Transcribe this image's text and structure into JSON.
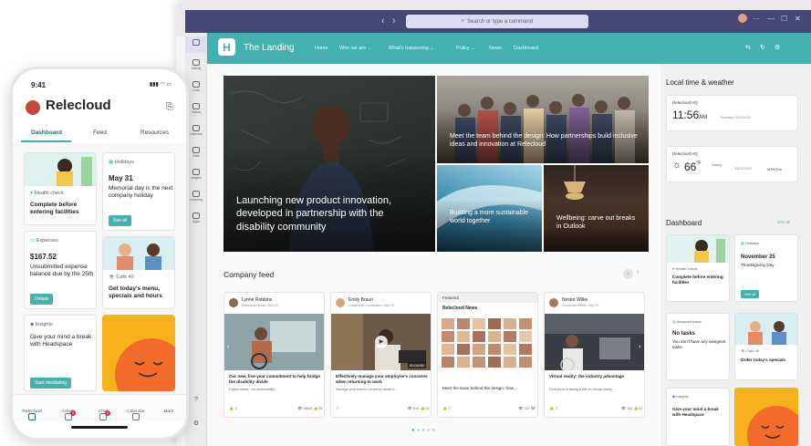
{
  "window": {
    "search_placeholder": "Search or type a command",
    "rail": [
      "Activity",
      "Chat",
      "Teams",
      "Calendar",
      "Files",
      "Insights",
      "Learning",
      "Apps"
    ]
  },
  "site": {
    "logo_letter": "H",
    "name": "The Landing",
    "nav": [
      "Home",
      "Who we are",
      "What's happening",
      "Policy",
      "News",
      "Dashboard"
    ]
  },
  "hero": {
    "t1": "Launching new product innovation, developed in partnership with the disability community",
    "t2": "Meet the team behind the design: How partnerships build inclusive ideas and innovation at Relecloud",
    "t3": "Building a more sustainable world together",
    "t4": "Wellbeing: carve out breaks in Outlook"
  },
  "feed": {
    "title": "Company feed",
    "cards": [
      {
        "name": "Lynne Robbins",
        "sub": "Relecloud News • Sep 19",
        "title": "Our new, five-year commitment to help bridge the disability divide",
        "desc": "Digital divide / an accessibility ...",
        "views": "28/25",
        "likes": "23"
      },
      {
        "name": "Emily Braun",
        "sub": "Leadership Connection • Sep 19",
        "title": "Effectively manage your employee's concerns when returning to work",
        "desc": "Manage your team's concerns about a ...",
        "video_time": "00:04:06",
        "views": "512",
        "likes": "23"
      },
      {
        "featured": "Featured",
        "name": "Relecloud News",
        "sub": "Relecloud News • Sep 19",
        "title": "Meet the team behind the design: how...",
        "views": "112",
        "likes": ""
      },
      {
        "name": "Nestor Wilke",
        "sub": "Consumer Retail • Sep 19",
        "title": "Virtual reality: the industry advantage",
        "desc": "Relecloud is taking a bet on virtual reality ...",
        "views": "112",
        "likes": "12"
      }
    ]
  },
  "right": {
    "time_title": "Local time & weather",
    "hq1": "Relecloud HQ",
    "time": "11:56",
    "ampm": "AM",
    "date": "Tuesday 9/21/2021",
    "hq2": "Relecloud HQ",
    "temp": "66",
    "unit": "°F",
    "cond": "Sunny",
    "date2": "09/21/2021",
    "src": "MSN We",
    "dash_title": "Dashboard",
    "see_all": "See all",
    "holidays_lab": "Holidays",
    "holiday_date": "November 25",
    "holiday_name": "Thanksgiving Day",
    "health_lab": "Health Check",
    "health_txt": "Complete before entering facilities",
    "health_btn": "See all",
    "tasks_lab": "Assigned tasks",
    "tasks_big": "No tasks",
    "tasks_txt": "You don't have any assigned tasks.",
    "cafe_lab": "Cafe 40",
    "cafe_txt": "Order today's specials",
    "insights_lab": "Insights",
    "insights_txt": "Give your mind a break with Headspace"
  },
  "phone": {
    "time": "9:41",
    "app": "Relecloud",
    "tabs": [
      "Dashboard",
      "Feed",
      "Resources"
    ],
    "health_lab": "Health check",
    "health_txt": "Complete before entering facilities",
    "holidays_lab": "Holidays",
    "holiday_date": "May 31",
    "holiday_txt": "Memorial day is the next company holiday",
    "holiday_btn": "See all",
    "expenses_lab": "Expenses",
    "expenses_amt": "$167.52",
    "expenses_txt": "Unsubmitted expense balance due by the 25th",
    "expenses_btn": "Details",
    "cafe_lab": "Café 40",
    "cafe_txt": "Get today's menu, specials and hours",
    "insights_lab": "Insights",
    "insights_txt": "Give your mind a break with Headspace",
    "insights_btn": "Start meditating",
    "nav": [
      "Relecloud",
      "Activity",
      "Chat",
      "Calendar",
      "More"
    ],
    "badge1": "2",
    "badge2": "2"
  },
  "colors": {
    "teal": "#43b2ae",
    "teams_purple": "#464775",
    "headspace_orange": "#f26b2a",
    "headspace_yellow": "#f6b21b"
  }
}
